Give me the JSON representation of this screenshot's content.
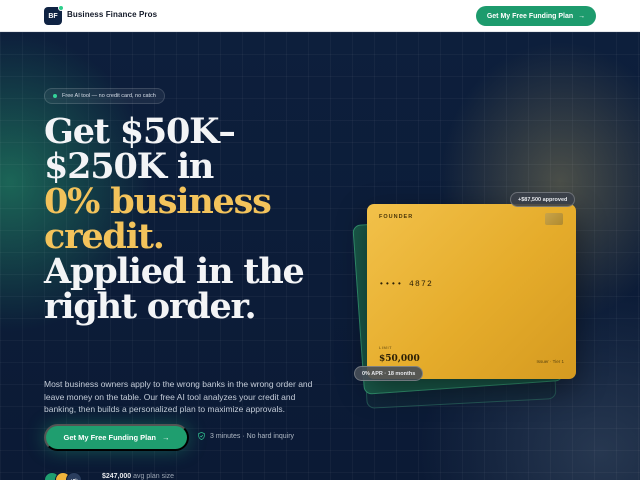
{
  "header": {
    "logo_text": "BF",
    "brand": "Business Finance Pros",
    "cta_label": "Get My Free Funding Plan",
    "cta_arrow": "→"
  },
  "hero": {
    "pill_text": "Free AI tool — no credit card, no catch",
    "headline_lines": [
      "Get $50K–",
      "$250K in",
      "0% business",
      "credit.",
      "Applied in the",
      "right order."
    ],
    "paragraph": "Most business owners apply to the wrong banks in the wrong order and leave money on the table. Our free AI tool analyzes your credit and banking, then builds a personalized plan to maximize approvals.",
    "cta_label": "Get My Free Funding Plan",
    "cta_arrow": "→",
    "meta_text": "3 minutes · No hard inquiry",
    "avatars": [
      "",
      "",
      "+8k"
    ],
    "stat_value": "$247,000",
    "stat_label": "avg plan size"
  },
  "card": {
    "label": "FOUNDER",
    "number": "•••• 4872",
    "limit_label": "LIMIT",
    "limit": "$50,000",
    "issuer": "Issuer · Tier 1",
    "approved_badge": "+$87,500 approved",
    "apr_badge": "0% APR · 18 months"
  },
  "colors": {
    "accent_green": "#1f9e6f",
    "gold_text": "#f3c35b",
    "card_gold": "#e9b232",
    "background_navy": "#0b1a35"
  }
}
